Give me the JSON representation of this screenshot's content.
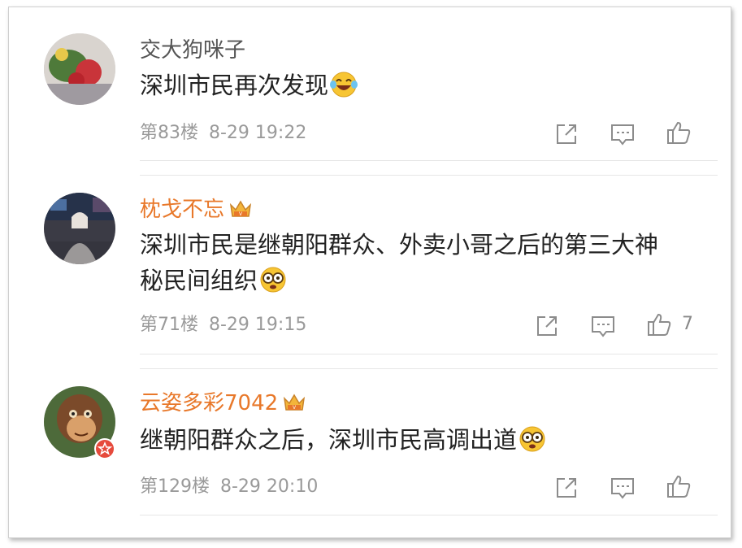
{
  "comments": [
    {
      "username": "交大狗咪子",
      "text": "深圳市民再次发现",
      "emoji": "laughing-tears-emoji",
      "floor": "第83楼",
      "time": "8-29 19:22",
      "likes": ""
    },
    {
      "username": "枕戈不忘",
      "text_line1": "深圳市民是继朝阳群众、外卖小哥之后的第三大神",
      "text_line2": "秘民间组织",
      "emoji": "spectacles-emoji",
      "floor": "第71楼",
      "time": "8-29 19:15",
      "likes": "7"
    },
    {
      "username": "云姿多彩7042",
      "text": "继朝阳群众之后，深圳市民高调出道",
      "emoji": "spectacles-emoji",
      "floor": "第129楼",
      "time": "8-29 20:10",
      "likes": ""
    }
  ],
  "colors": {
    "vip_name": "#e8782a",
    "normal_name": "#555555",
    "meta_text": "#9a9a9a",
    "icon_gray": "#8c8c8c",
    "badge_red": "#e64a3c"
  },
  "icons": [
    "share-icon",
    "reply-icon",
    "like-icon",
    "vip-crown-icon",
    "verified-badge-icon"
  ]
}
